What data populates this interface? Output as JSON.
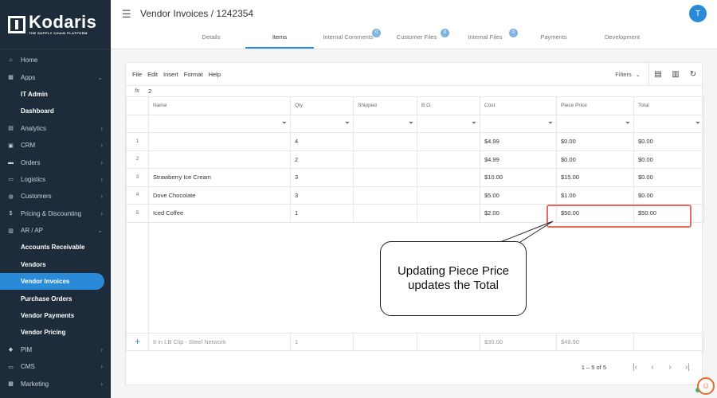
{
  "brand": {
    "name": "Kodaris",
    "tagline": "THE SUPPLY CHAIN PLATFORM"
  },
  "sidebar": {
    "items": [
      {
        "label": "Home",
        "icon": "home-icon",
        "glyph": "⌂",
        "chevron": ""
      },
      {
        "label": "Apps",
        "icon": "grid-icon",
        "glyph": "▦",
        "chevron": "⌄"
      },
      {
        "label": "IT Admin",
        "sub": true
      },
      {
        "label": "Dashboard",
        "sub": true
      },
      {
        "label": "Analytics",
        "icon": "chart-icon",
        "glyph": "▤",
        "chevron": "›"
      },
      {
        "label": "CRM",
        "icon": "contact-icon",
        "glyph": "▣",
        "chevron": "›"
      },
      {
        "label": "Orders",
        "icon": "truck-icon",
        "glyph": "▬",
        "chevron": "›"
      },
      {
        "label": "Logistics",
        "icon": "delivery-icon",
        "glyph": "▭",
        "chevron": "›"
      },
      {
        "label": "Customers",
        "icon": "users-icon",
        "glyph": "◍",
        "chevron": "›"
      },
      {
        "label": "Pricing & Discounting",
        "icon": "dollar-icon",
        "glyph": "$",
        "chevron": "›"
      },
      {
        "label": "AR / AP",
        "icon": "bank-icon",
        "glyph": "▥",
        "chevron": "⌄"
      },
      {
        "label": "Accounts Receivable",
        "sub": true
      },
      {
        "label": "Vendors",
        "sub": true
      },
      {
        "label": "Vendor Invoices",
        "sub": true,
        "active": true
      },
      {
        "label": "Purchase Orders",
        "sub": true
      },
      {
        "label": "Vendor Payments",
        "sub": true
      },
      {
        "label": "Vendor Pricing",
        "sub": true
      },
      {
        "label": "PIM",
        "icon": "tag-icon",
        "glyph": "◆",
        "chevron": "›"
      },
      {
        "label": "CMS",
        "icon": "layout-icon",
        "glyph": "▭",
        "chevron": "›"
      },
      {
        "label": "Marketing",
        "icon": "megaphone-icon",
        "glyph": "▩",
        "chevron": "›"
      }
    ]
  },
  "header": {
    "title": "Vendor Invoices / 1242354",
    "avatar_initial": "T",
    "tabs": [
      {
        "label": "Details",
        "badge": ""
      },
      {
        "label": "Items",
        "badge": "",
        "active": true
      },
      {
        "label": "Internal Comments",
        "badge": "0"
      },
      {
        "label": "Customer Files",
        "badge": "0"
      },
      {
        "label": "Internal Files",
        "badge": "0"
      },
      {
        "label": "Payments",
        "badge": ""
      },
      {
        "label": "Development",
        "badge": ""
      }
    ]
  },
  "toolbar": {
    "menus": [
      "File",
      "Edit",
      "Insert",
      "Format",
      "Help"
    ],
    "filters_label": "Filters",
    "fx_label": "fx",
    "fx_value": "2"
  },
  "grid": {
    "columns": [
      "Name",
      "Qty",
      "Shipped",
      "B.O.",
      "Cost",
      "Piece Price",
      "Total"
    ],
    "rows": [
      {
        "idx": "1",
        "name": "",
        "qty": "4",
        "shipped": "",
        "bo": "",
        "cost": "$4.99",
        "piece_price": "$0.00",
        "total": "$0.00"
      },
      {
        "idx": "2",
        "name": "",
        "qty": "2",
        "shipped": "",
        "bo": "",
        "cost": "$4.99",
        "piece_price": "$0.00",
        "total": "$0.00"
      },
      {
        "idx": "3",
        "name": "Strawberry Ice Cream",
        "qty": "3",
        "shipped": "",
        "bo": "",
        "cost": "$10.00",
        "piece_price": "$15.00",
        "total": "$0.00"
      },
      {
        "idx": "4",
        "name": "Dove Chocolate",
        "qty": "3",
        "shipped": "",
        "bo": "",
        "cost": "$5.00",
        "piece_price": "$1.00",
        "total": "$0.00"
      },
      {
        "idx": "5",
        "name": "Iced Coffee",
        "qty": "1",
        "shipped": "",
        "bo": "",
        "cost": "$2.00",
        "piece_price": "$50.00",
        "total": "$50.00"
      }
    ],
    "add_row": {
      "name": "8 in LB Clip - Steel Network",
      "qty": "1",
      "cost": "$30.00",
      "piece_price": "$48.90"
    }
  },
  "annotation": {
    "line1": "Updating Piece Price",
    "line2": "updates the Total"
  },
  "pagination": {
    "label": "1 – 5 of 5"
  },
  "colors": {
    "accent": "#2b8ad8",
    "sidebar_bg": "#1e2b3a",
    "highlight": "#e66a5e",
    "chat": "#e8692b"
  }
}
